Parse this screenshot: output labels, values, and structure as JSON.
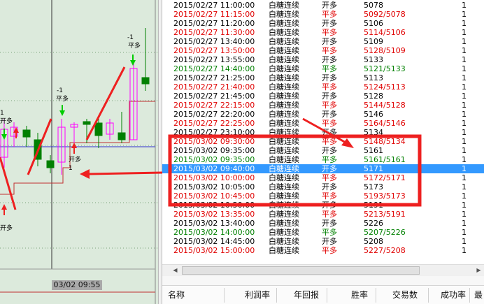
{
  "chart": {
    "cursor_time": "03/02 09:55",
    "annotations": {
      "sig1_qty": "-1",
      "sig1_act": "平多",
      "sig2_qty": "-1",
      "sig2_act": "平多",
      "sig3_qty": "1",
      "sig3_act": "开多",
      "sig4_qty": "1",
      "sig4_act": "开多",
      "sig5_act": "开多"
    }
  },
  "trades": [
    {
      "time": "2015/02/27 11:00:00",
      "name": "白糖连续",
      "action": "开多",
      "price": "5078",
      "qty": "1",
      "color": "#000000"
    },
    {
      "time": "2015/02/27 11:15:00",
      "name": "白糖连续",
      "action": "平多",
      "price": "5092/5078",
      "qty": "1",
      "color": "#e00000"
    },
    {
      "time": "2015/02/27 11:20:00",
      "name": "白糖连续",
      "action": "开多",
      "price": "5106",
      "qty": "1",
      "color": "#000000"
    },
    {
      "time": "2015/02/27 11:30:00",
      "name": "白糖连续",
      "action": "平多",
      "price": "5114/5106",
      "qty": "1",
      "color": "#e00000"
    },
    {
      "time": "2015/02/27 13:40:00",
      "name": "白糖连续",
      "action": "开多",
      "price": "5109",
      "qty": "1",
      "color": "#000000"
    },
    {
      "time": "2015/02/27 13:50:00",
      "name": "白糖连续",
      "action": "平多",
      "price": "5128/5109",
      "qty": "1",
      "color": "#e00000"
    },
    {
      "time": "2015/02/27 13:55:00",
      "name": "白糖连续",
      "action": "开多",
      "price": "5133",
      "qty": "1",
      "color": "#000000"
    },
    {
      "time": "2015/02/27 14:40:00",
      "name": "白糖连续",
      "action": "平多",
      "price": "5121/5133",
      "qty": "1",
      "color": "#008000"
    },
    {
      "time": "2015/02/27 21:25:00",
      "name": "白糖连续",
      "action": "开多",
      "price": "5113",
      "qty": "1",
      "color": "#000000"
    },
    {
      "time": "2015/02/27 21:40:00",
      "name": "白糖连续",
      "action": "平多",
      "price": "5124/5113",
      "qty": "1",
      "color": "#e00000"
    },
    {
      "time": "2015/02/27 21:45:00",
      "name": "白糖连续",
      "action": "开多",
      "price": "5128",
      "qty": "1",
      "color": "#000000"
    },
    {
      "time": "2015/02/27 22:15:00",
      "name": "白糖连续",
      "action": "平多",
      "price": "5144/5128",
      "qty": "1",
      "color": "#e00000"
    },
    {
      "time": "2015/02/27 22:20:00",
      "name": "白糖连续",
      "action": "开多",
      "price": "5146",
      "qty": "1",
      "color": "#000000"
    },
    {
      "time": "2015/02/27 22:25:00",
      "name": "白糖连续",
      "action": "平多",
      "price": "5164/5146",
      "qty": "1",
      "color": "#e00000"
    },
    {
      "time": "2015/02/27 23:10:00",
      "name": "白糖连续",
      "action": "开多",
      "price": "5134",
      "qty": "1",
      "color": "#000000"
    },
    {
      "time": "2015/03/02 09:30:00",
      "name": "白糖连续",
      "action": "平多",
      "price": "5148/5134",
      "qty": "1",
      "color": "#e00000"
    },
    {
      "time": "2015/03/02 09:35:00",
      "name": "白糖连续",
      "action": "开多",
      "price": "5161",
      "qty": "1",
      "color": "#000000"
    },
    {
      "time": "2015/03/02 09:35:00",
      "name": "白糖连续",
      "action": "平多",
      "price": "5161/5161",
      "qty": "1",
      "color": "#008000"
    },
    {
      "time": "2015/03/02 09:40:00",
      "name": "白糖连续",
      "action": "开多",
      "price": "5171",
      "qty": "1",
      "color": "#000000",
      "selected": true
    },
    {
      "time": "2015/03/02 10:00:00",
      "name": "白糖连续",
      "action": "平多",
      "price": "5172/5171",
      "qty": "1",
      "color": "#e00000"
    },
    {
      "time": "2015/03/02 10:05:00",
      "name": "白糖连续",
      "action": "开多",
      "price": "5173",
      "qty": "1",
      "color": "#000000"
    },
    {
      "time": "2015/03/02 10:45:00",
      "name": "白糖连续",
      "action": "平多",
      "price": "5193/5173",
      "qty": "1",
      "color": "#e00000"
    },
    {
      "time": "2015/03/02 10:50:00",
      "name": "白糖连续",
      "action": "开多",
      "price": "5191",
      "qty": "1",
      "color": "#000000"
    },
    {
      "time": "2015/03/02 13:35:00",
      "name": "白糖连续",
      "action": "平多",
      "price": "5213/5191",
      "qty": "1",
      "color": "#e00000"
    },
    {
      "time": "2015/03/02 13:40:00",
      "name": "白糖连续",
      "action": "开多",
      "price": "5226",
      "qty": "1",
      "color": "#000000"
    },
    {
      "time": "2015/03/02 14:00:00",
      "name": "白糖连续",
      "action": "平多",
      "price": "5207/5226",
      "qty": "1",
      "color": "#008000"
    },
    {
      "time": "2015/03/02 14:45:00",
      "name": "白糖连续",
      "action": "开多",
      "price": "5208",
      "qty": "1",
      "color": "#000000"
    },
    {
      "time": "2015/03/02 15:00:00",
      "name": "白糖连续",
      "action": "平多",
      "price": "5227/5208",
      "qty": "1",
      "color": "#e00000"
    }
  ],
  "summary_header": {
    "col_name": "名称",
    "col_profit_rate": "利润率",
    "col_annual_return": "年回报",
    "col_win_rate": "胜率",
    "col_trades": "交易数",
    "col_success_rate": "成功率",
    "col_last": "最"
  },
  "colors": {
    "chart_bg": "#dceadc",
    "up_candle": "#ff00ff",
    "down_candle": "#008000",
    "annotation_red": "#ee2020",
    "selection": "#3399ff"
  }
}
